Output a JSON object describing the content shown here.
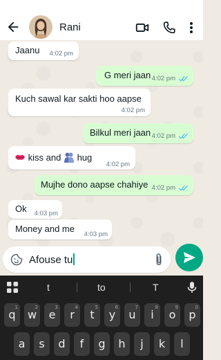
{
  "header": {
    "contact_name": "Rani",
    "icons": [
      "back-arrow-icon",
      "video-call-icon",
      "phone-icon",
      "more-vert-icon"
    ]
  },
  "messages": [
    {
      "direction": "in",
      "text": "Jaanu",
      "time": "4:02 pm"
    },
    {
      "direction": "out",
      "text": "G meri jaan",
      "time": "4:02 pm",
      "status": "read"
    },
    {
      "direction": "in",
      "text": "Kuch sawal kar sakti hoo aapse",
      "time": "4:02 pm"
    },
    {
      "direction": "out",
      "text": "Bilkul meri jaan",
      "time": "4:02 pm",
      "status": "read"
    },
    {
      "direction": "in",
      "text_parts": [
        "kiss and",
        "hug"
      ],
      "emojis": [
        "kiss-mark-emoji",
        "people-hugging-emoji"
      ],
      "time": "4:02 pm"
    },
    {
      "direction": "out",
      "text": "Mujhe dono aapse chahiye",
      "time": "4:02 pm",
      "status": "read"
    },
    {
      "direction": "in",
      "text": "Ok",
      "time": "4:03 pm"
    },
    {
      "direction": "in",
      "text": "Money and me",
      "time": "4:03 pm"
    }
  ],
  "composer": {
    "text": "Afouse tu",
    "icons": [
      "sticker-icon",
      "attach-icon",
      "send-icon"
    ]
  },
  "keyboard": {
    "suggestions": [
      "t",
      "to",
      "T"
    ],
    "row1": [
      "q",
      "w",
      "e",
      "r",
      "t",
      "y",
      "u",
      "i",
      "o",
      "p"
    ],
    "row1_hints": [
      "1",
      "2",
      "3",
      "4",
      "5",
      "6",
      "7",
      "8",
      "9",
      "0"
    ],
    "row2": [
      "a",
      "s",
      "d",
      "f",
      "g",
      "h",
      "j",
      "k",
      "l"
    ],
    "icons": [
      "apps-grid-icon",
      "mic-icon"
    ]
  },
  "colors": {
    "chat_bg": "#efeae2",
    "outgoing_bubble": "#d9fdd3",
    "accent": "#00a884",
    "read_tick": "#53bdeb",
    "keyboard_bg": "#1f1f1f"
  }
}
